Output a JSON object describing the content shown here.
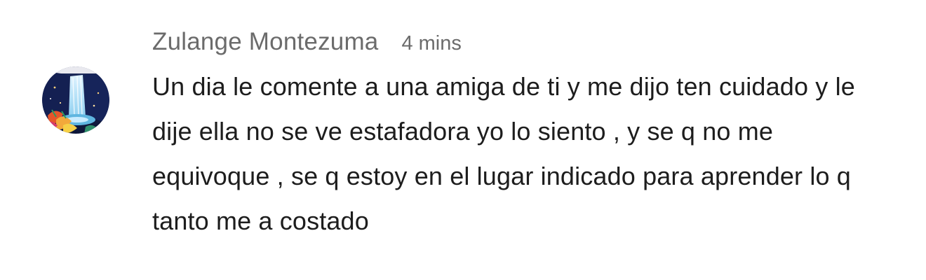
{
  "comment": {
    "author": "Zulange Montezuma",
    "timestamp": "4 mins",
    "avatar_icon": "waterfall-avatar-icon",
    "text": "Un dia le comente a una amiga de ti y me dijo ten cuidado y le dije ella no se ve estafadora yo lo siento , y se q no me equivoque , se q estoy en el lugar indicado para aprender lo q tanto me a costado"
  },
  "colors": {
    "meta_text": "#6b6b6b",
    "body_text": "#1d1d1d",
    "background": "#ffffff"
  }
}
